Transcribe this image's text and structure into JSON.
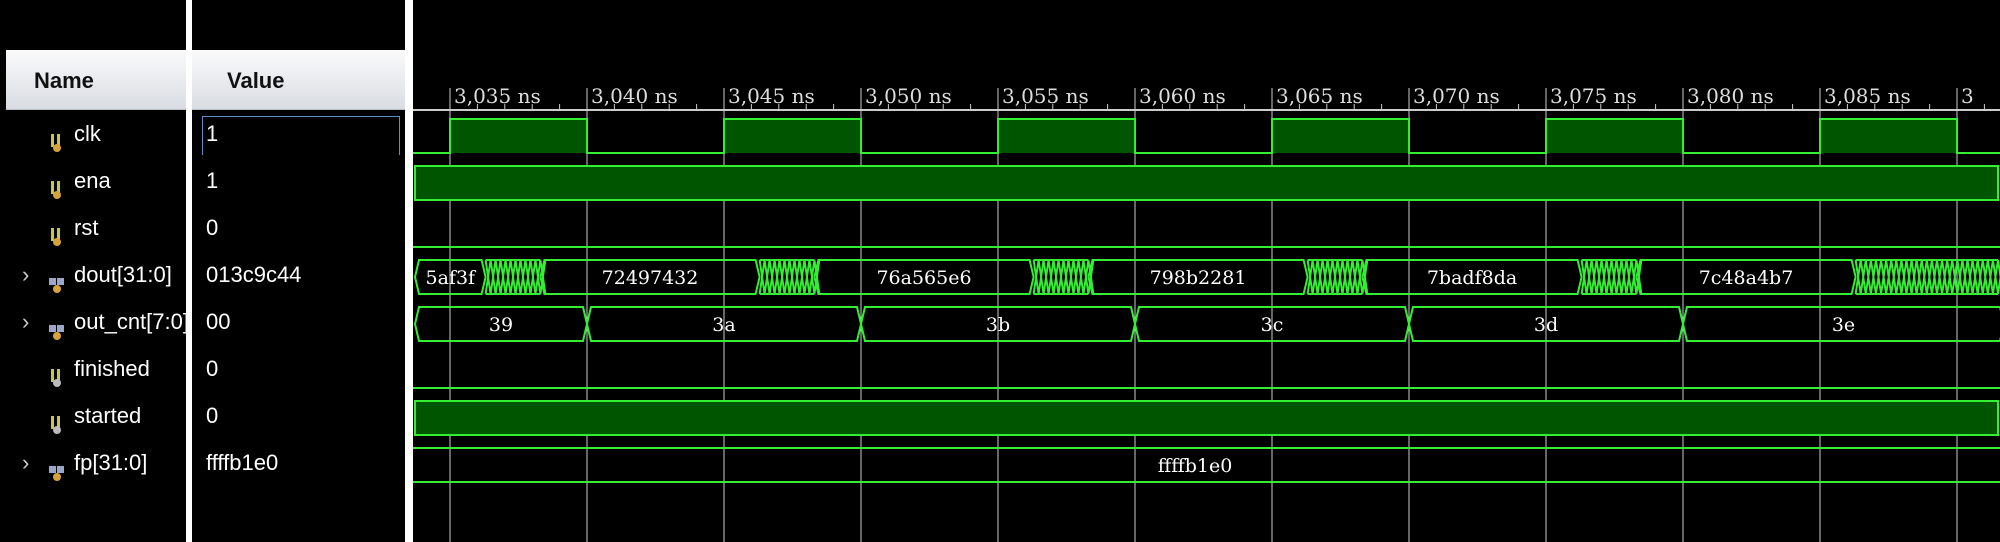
{
  "headers": {
    "name": "Name",
    "value": "Value"
  },
  "signals": [
    {
      "name": "clk",
      "value": "1",
      "kind": "bit",
      "expandable": false,
      "icon": "bit-signal-icon",
      "selected": true
    },
    {
      "name": "ena",
      "value": "1",
      "kind": "bit",
      "expandable": false,
      "icon": "bit-signal-icon"
    },
    {
      "name": "rst",
      "value": "0",
      "kind": "bit",
      "expandable": false,
      "icon": "bit-signal-icon"
    },
    {
      "name": "dout[31:0]",
      "value": "013c9c44",
      "kind": "bus",
      "expandable": true,
      "icon": "bus-signal-icon"
    },
    {
      "name": "out_cnt[7:0]",
      "value": "00",
      "kind": "bus",
      "expandable": true,
      "icon": "bus-signal-icon"
    },
    {
      "name": "finished",
      "value": "0",
      "kind": "bit",
      "expandable": false,
      "icon": "output-bit-icon"
    },
    {
      "name": "started",
      "value": "0",
      "kind": "bit",
      "expandable": false,
      "icon": "output-bit-icon"
    },
    {
      "name": "fp[31:0]",
      "value": "ffffb1e0",
      "kind": "bus",
      "expandable": true,
      "icon": "bus-signal-icon"
    }
  ],
  "timeline": {
    "ticks": [
      "3,035 ns",
      "3,040 ns",
      "3,045 ns",
      "3,050 ns",
      "3,055 ns",
      "3,060 ns",
      "3,065 ns",
      "3,070 ns",
      "3,075 ns",
      "3,080 ns",
      "3,085 ns",
      "3"
    ]
  },
  "waves": {
    "dout_values": [
      "5af3f",
      "72497432",
      "76a565e6",
      "798b2281",
      "7badf8da",
      "7c48a4b7"
    ],
    "out_cnt_values": [
      "39",
      "3a",
      "3b",
      "3c",
      "3d",
      "3e"
    ],
    "fp_value": "ffffb1e0"
  },
  "colors": {
    "wave": "#33ee33",
    "fill": "#005500",
    "grid": "#cccccc",
    "select": "#5a90c8",
    "bg": "#000000"
  }
}
